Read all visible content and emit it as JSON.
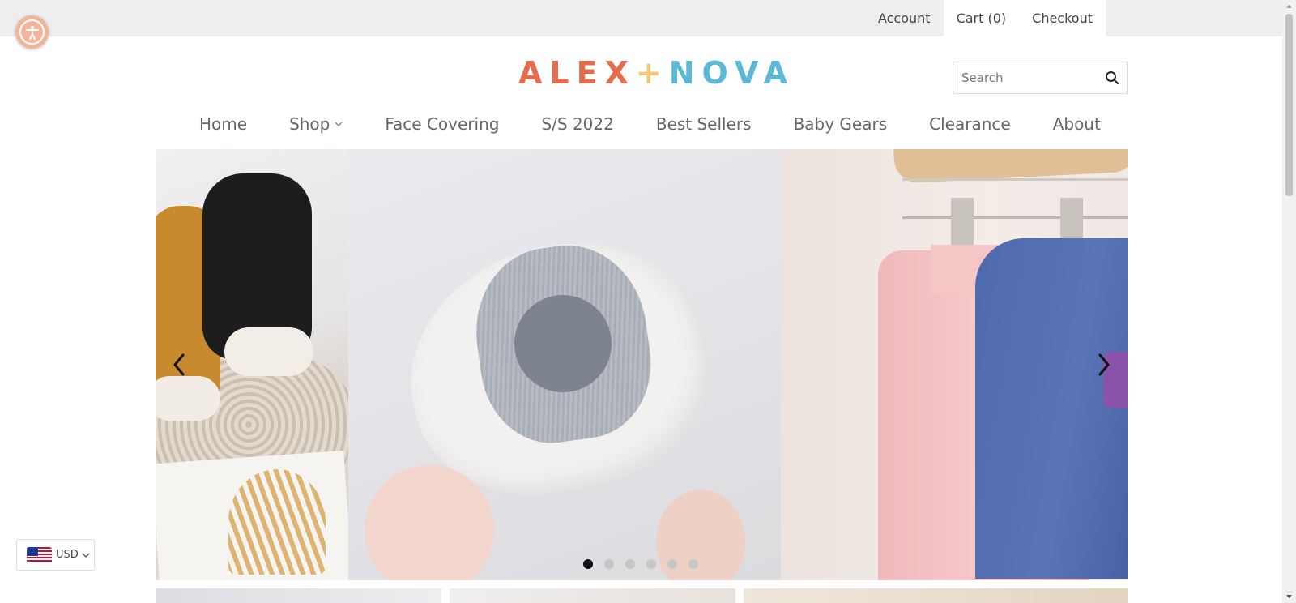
{
  "topbar": {
    "account_label": "Account",
    "cart_label": "Cart (0)",
    "checkout_label": "Checkout"
  },
  "brand": {
    "logo_part1": "ALEX",
    "logo_plus": "+",
    "logo_part2": "NOVA",
    "colors": {
      "primary": "#e76b4d",
      "plus": "#f7c86b",
      "secondary": "#5bb8d6"
    }
  },
  "search": {
    "placeholder": "Search",
    "icon": "search-icon"
  },
  "nav": {
    "items": [
      {
        "label": "Home"
      },
      {
        "label": "Shop",
        "has_dropdown": true
      },
      {
        "label": "Face Covering"
      },
      {
        "label": "S/S 2022"
      },
      {
        "label": "Best Sellers"
      },
      {
        "label": "Baby Gears"
      },
      {
        "label": "Clearance"
      },
      {
        "label": "About"
      }
    ]
  },
  "slideshow": {
    "slide_count": 6,
    "active_slide": 1,
    "icons": {
      "prev": "chevron-left-icon",
      "next": "chevron-right-icon"
    }
  },
  "currency": {
    "code": "USD",
    "flag": "us-flag-icon"
  },
  "accessibility": {
    "icon": "accessibility-icon"
  }
}
